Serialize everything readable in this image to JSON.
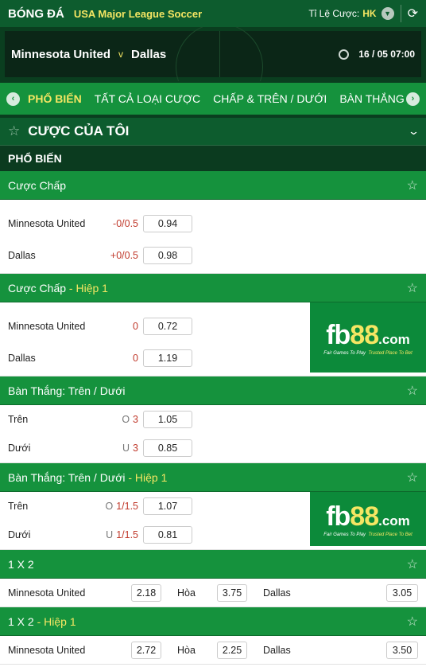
{
  "topbar": {
    "brand": "BÓNG ĐÁ",
    "league": "USA Major League Soccer",
    "odds_label": "Tỉ Lệ Cược:",
    "odds_format": "HK"
  },
  "match": {
    "home": "Minnesota United",
    "vs": "v",
    "away": "Dallas",
    "kickoff": "16 / 05  07:00"
  },
  "tabs": [
    "PHỔ BIẾN",
    "TẤT CẢ LOẠI CƯỢC",
    "CHẤP & TRÊN / DƯỚI",
    "BÀN THẮNG"
  ],
  "mybets": {
    "title": "CƯỢC CỦA TÔI"
  },
  "section": {
    "title": "PHỔ BIẾN"
  },
  "banner": {
    "fb": "fb",
    "num": "88",
    "dom": ".com",
    "tag1": "Fair Games To Play",
    "tag2": "Trusted Place To Bet"
  },
  "markets": {
    "handicap": {
      "title": "Cược Chấp",
      "rows": [
        {
          "name": "Minnesota United",
          "line": "-0/0.5",
          "odd": "0.94"
        },
        {
          "name": "Dallas",
          "line": "+0/0.5",
          "odd": "0.98"
        }
      ]
    },
    "handicap_h1": {
      "title": "Cược Chấp",
      "half": "- Hiệp 1",
      "rows": [
        {
          "name": "Minnesota United",
          "line": "0",
          "odd": "0.72"
        },
        {
          "name": "Dallas",
          "line": "0",
          "odd": "1.19"
        }
      ]
    },
    "ou": {
      "title": "Bàn Thắng: Trên / Dưới",
      "rows": [
        {
          "name": "Trên",
          "ou": "O",
          "line": "3",
          "odd": "1.05"
        },
        {
          "name": "Dưới",
          "ou": "U",
          "line": "3",
          "odd": "0.85"
        }
      ]
    },
    "ou_h1": {
      "title": "Bàn Thắng: Trên / Dưới",
      "half": "- Hiệp 1",
      "rows": [
        {
          "name": "Trên",
          "ou": "O",
          "line": "1/1.5",
          "odd": "1.07"
        },
        {
          "name": "Dưới",
          "ou": "U",
          "line": "1/1.5",
          "odd": "0.81"
        }
      ]
    },
    "x12": {
      "title": "1 X 2",
      "home": "Minnesota United",
      "home_odd": "2.18",
      "draw": "Hòa",
      "draw_odd": "3.75",
      "away": "Dallas",
      "away_odd": "3.05"
    },
    "x12_h1": {
      "title": "1 X 2",
      "half": "- Hiệp 1",
      "home": "Minnesota United",
      "home_odd": "2.72",
      "draw": "Hòa",
      "draw_odd": "2.25",
      "away": "Dallas",
      "away_odd": "3.50"
    }
  },
  "colors": {
    "brand_green": "#15923d",
    "dark_green": "#0d5c2e",
    "accent_yellow": "#f5e663",
    "line_red": "#c0392b"
  }
}
